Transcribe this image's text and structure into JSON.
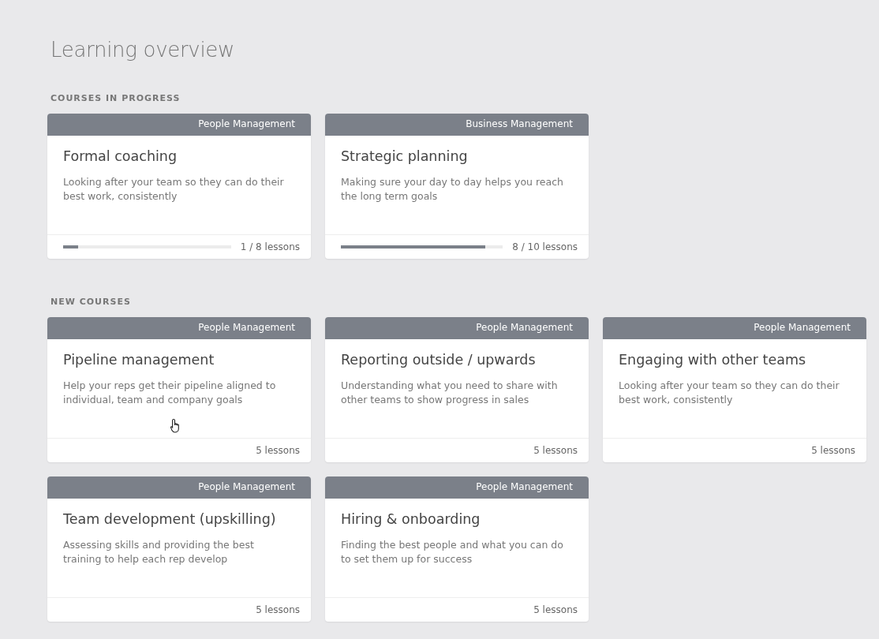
{
  "page": {
    "title": "Learning overview"
  },
  "sections": [
    {
      "heading": "COURSES IN PROGRESS",
      "courses": [
        {
          "kind": "progress",
          "category": "People Management",
          "title": "Formal coaching",
          "description": "Looking after your team so they can do their best work, consistently",
          "level": 0.09,
          "lessons": "1 / 8 lessons"
        },
        {
          "kind": "progress",
          "category": "Business Management",
          "title": "Strategic planning",
          "description": "Making sure your day to day helps you reach the long term goals",
          "level": 0.89,
          "lessons": "8 / 10 lessons"
        }
      ]
    },
    {
      "heading": "NEW COURSES",
      "courses": [
        {
          "kind": "new",
          "category": "People Management",
          "title": "Pipeline management",
          "description": "Help your reps get  their pipeline aligned to individual, team and company goals",
          "lessons": "5 lessons"
        },
        {
          "kind": "new",
          "category": "People Management",
          "title": "Reporting outside / upwards",
          "description": "Understanding what you need to share with other teams to show progress in sales",
          "lessons": "5 lessons"
        },
        {
          "kind": "new",
          "category": "People Management",
          "title": "Engaging with other teams",
          "description": "Looking after your team so they can do their best work, consistently",
          "lessons": "5 lessons"
        },
        {
          "kind": "new",
          "category": "People Management",
          "title": "Team development (upskilling)",
          "description": "Assessing skills and providing the best training to help each rep develop",
          "lessons": "5 lessons"
        },
        {
          "kind": "new",
          "category": "People Management",
          "title": "Hiring & onboarding",
          "description": "Finding the best people and what you can do to set them up for success",
          "lessons": "5 lessons"
        }
      ]
    }
  ]
}
